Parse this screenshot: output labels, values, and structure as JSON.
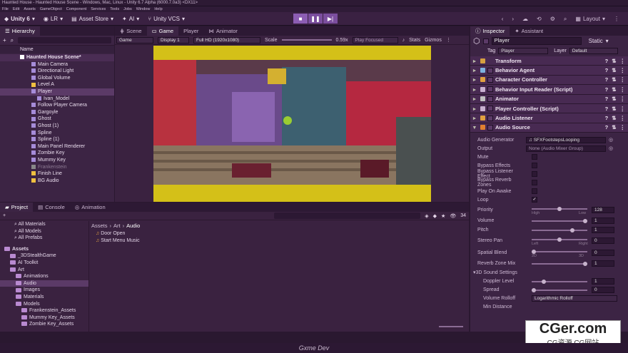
{
  "title_bar": "Haunted House - Haunted House Scene - Windows, Mac, Linux - Unity 6.7 Alpha (6000.7.0a3) <DX11>",
  "menu": [
    "File",
    "Edit",
    "Assets",
    "GameObject",
    "Component",
    "Services",
    "Tools",
    "Jobs",
    "Window",
    "Help"
  ],
  "toolbar": {
    "unity": "Unity 6",
    "account": "LR",
    "asset_store": "Asset Store",
    "ai": "AI",
    "vcs": "Unity VCS",
    "layout": "Layout"
  },
  "hierarchy": {
    "tab": "Hierarchy",
    "column": "Name",
    "items": [
      "Haunted House Scene*",
      "Main Camera",
      "Directional Light",
      "Global Volume",
      "Level A",
      "Player",
      "Ivan_Model",
      "Follow Player Camera",
      "Gargoyle",
      "Ghost",
      "Ghost (1)",
      "Spline",
      "Spline (1)",
      "Main Panel Renderer",
      "Zombie Key",
      "Mummy Key",
      "Frankenstein",
      "Finish Line",
      "BG Audio"
    ]
  },
  "scene": {
    "tabs": [
      "Scene",
      "Game",
      "Player",
      "Animator"
    ],
    "display_mode": "Game",
    "display": "Display 1",
    "resolution": "Full HD (1920x1080)",
    "scale_label": "Scale",
    "scale_value": "0.59x",
    "play_mode": "Play Focused",
    "stats": "Stats",
    "gizmos": "Gizmos"
  },
  "inspector": {
    "tabs": [
      "Inspector",
      "Assistant"
    ],
    "object": "Player",
    "static": "Static",
    "tag_label": "Tag",
    "tag": "Player",
    "layer_label": "Layer",
    "layer": "Default",
    "components": [
      "Transform",
      "Behavior Agent",
      "Character Controller",
      "Behavior Input Reader (Script)",
      "Animator",
      "Player Controller (Script)",
      "Audio Listener",
      "Audio Source"
    ],
    "audio": {
      "generator_label": "Audio Generator",
      "generator": "SFXFootstepsLooping",
      "output_label": "Output",
      "output": "None (Audio Mixer Group)",
      "mute": "Mute",
      "bypass_effects": "Bypass Effects",
      "bypass_listener": "Bypass Listener Effect",
      "bypass_reverb": "Bypass Reverb Zones",
      "play_on_awake": "Play On Awake",
      "loop": "Loop",
      "priority_label": "Priority",
      "priority": "128",
      "priority_high": "High",
      "priority_low": "Low",
      "volume_label": "Volume",
      "volume": "1",
      "pitch_label": "Pitch",
      "pitch": "1",
      "pan_label": "Stereo Pan",
      "pan": "0",
      "pan_left": "Left",
      "pan_right": "Right",
      "blend_label": "Spatial Blend",
      "blend": "0",
      "blend_2d": "2D",
      "blend_3d": "3D",
      "reverb_label": "Reverb Zone Mix",
      "reverb": "1",
      "sound3d": "3D Sound Settings",
      "doppler_label": "Doppler Level",
      "doppler": "1",
      "spread_label": "Spread",
      "spread": "0",
      "rolloff_label": "Volume Rolloff",
      "rolloff": "Logarithmic Rolloff",
      "mindist_label": "Min Distance"
    }
  },
  "project": {
    "tabs": [
      "Project",
      "Console",
      "Animation"
    ],
    "favorites": [
      "All Materials",
      "All Models",
      "All Prefabs"
    ],
    "tree": [
      "Assets",
      "_3DStealthGame",
      "AI Toolkit",
      "Art",
      "Animations",
      "Audio",
      "Images",
      "Materials",
      "Models",
      "Frankenstein_Assets",
      "Mummy Key_Assets",
      "Zombie Key_Assets"
    ],
    "breadcrumb": [
      "Assets",
      "Art",
      "Audio"
    ],
    "files": [
      "Door Open",
      "Start Menu Music"
    ],
    "count": "34"
  },
  "footer": "Gxme Dev",
  "watermark": {
    "brand": "CGer.com",
    "sub": "CG资源 CG网站"
  }
}
